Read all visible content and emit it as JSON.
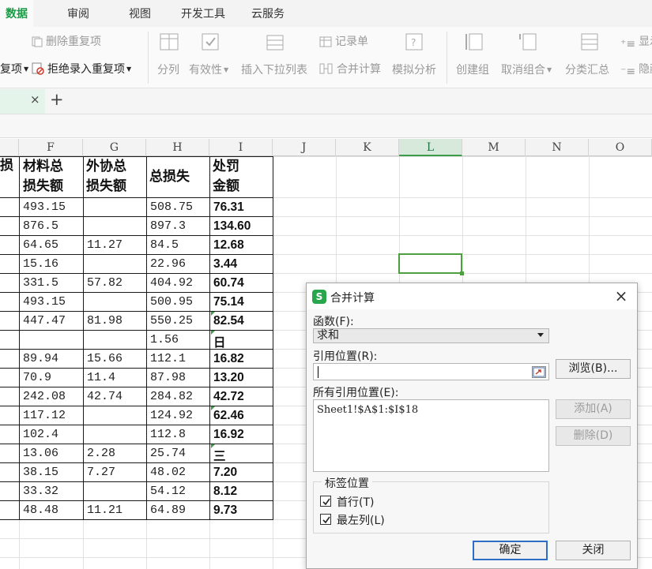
{
  "ribbon": {
    "tabs": [
      {
        "label": "数据",
        "active": true
      },
      {
        "label": "审阅",
        "active": false
      },
      {
        "label": "视图",
        "active": false
      },
      {
        "label": "开发工具",
        "active": false
      },
      {
        "label": "云服务",
        "active": false
      }
    ],
    "remove_duplicates": "删除重复项",
    "duplicates_dropdown": "复项",
    "reject_duplicate_entry": "拒绝录入重复项",
    "split_columns": "分列",
    "validity": "有效性",
    "insert_dropdown_list": "插入下拉列表",
    "record_form": "记录单",
    "consolidate": "合并计算",
    "what_if_analysis": "模拟分析",
    "group": "创建组",
    "ungroup": "取消组合",
    "subtotal": "分类汇总",
    "show_detail": "显示",
    "hide_detail": "隐藏"
  },
  "sheet_tab": {
    "close": "×",
    "add": "+"
  },
  "sheet": {
    "columns": [
      "F",
      "G",
      "H",
      "I",
      "J",
      "K",
      "L",
      "M",
      "N",
      "O"
    ],
    "selected_column": "L",
    "partial_header_char": "损",
    "headers": {
      "F": [
        "材料总",
        "损失额"
      ],
      "G": [
        "外协总",
        "损失额"
      ],
      "H": [
        "总损失"
      ],
      "I": [
        "处罚",
        "金额"
      ]
    },
    "rows": [
      [
        "493.15",
        "",
        "508.75",
        "76.31"
      ],
      [
        "876.5",
        "",
        "897.3",
        "134.60"
      ],
      [
        "64.65",
        "11.27",
        "84.5",
        "12.68"
      ],
      [
        "15.16",
        "",
        "22.96",
        "3.44"
      ],
      [
        "331.5",
        "57.82",
        "404.92",
        "60.74"
      ],
      [
        "493.15",
        "",
        "500.95",
        "75.14"
      ],
      [
        "447.47",
        "81.98",
        "550.25",
        "82.54"
      ],
      [
        "",
        "",
        "1.56",
        "日"
      ],
      [
        "89.94",
        "15.66",
        "112.1",
        "16.82"
      ],
      [
        "70.9",
        "11.4",
        "87.98",
        "13.20"
      ],
      [
        "242.08",
        "42.74",
        "284.82",
        "42.72"
      ],
      [
        "117.12",
        "",
        "124.92",
        "62.46"
      ],
      [
        "102.4",
        "",
        "112.8",
        "16.92"
      ],
      [
        "13.06",
        "2.28",
        "25.74",
        "三"
      ],
      [
        "38.15",
        "7.27",
        "48.02",
        "7.20"
      ],
      [
        "33.32",
        "",
        "54.12",
        "8.12"
      ],
      [
        "48.48",
        "11.21",
        "64.89",
        "9.73"
      ]
    ]
  },
  "dialog": {
    "title": "合并计算",
    "close": "×",
    "function_label": "函数(F):",
    "function_value": "求和",
    "reference_label": "引用位置(R):",
    "reference_value": "",
    "browse_button": "浏览(B)...",
    "all_references_label": "所有引用位置(E):",
    "all_references": [
      "Sheet1!$A$1:$I$18"
    ],
    "add_button": "添加(A)",
    "delete_button": "删除(D)",
    "label_position_title": "标签位置",
    "top_row_label": "首行(T)",
    "top_row_checked": true,
    "left_column_label": "最左列(L)",
    "left_column_checked": true,
    "ok_button": "确定",
    "close_button": "关闭"
  },
  "colors": {
    "accent_green": "#1a9b46",
    "selection_green": "#4d9f3f",
    "default_button_border": "#2d6fc6"
  }
}
